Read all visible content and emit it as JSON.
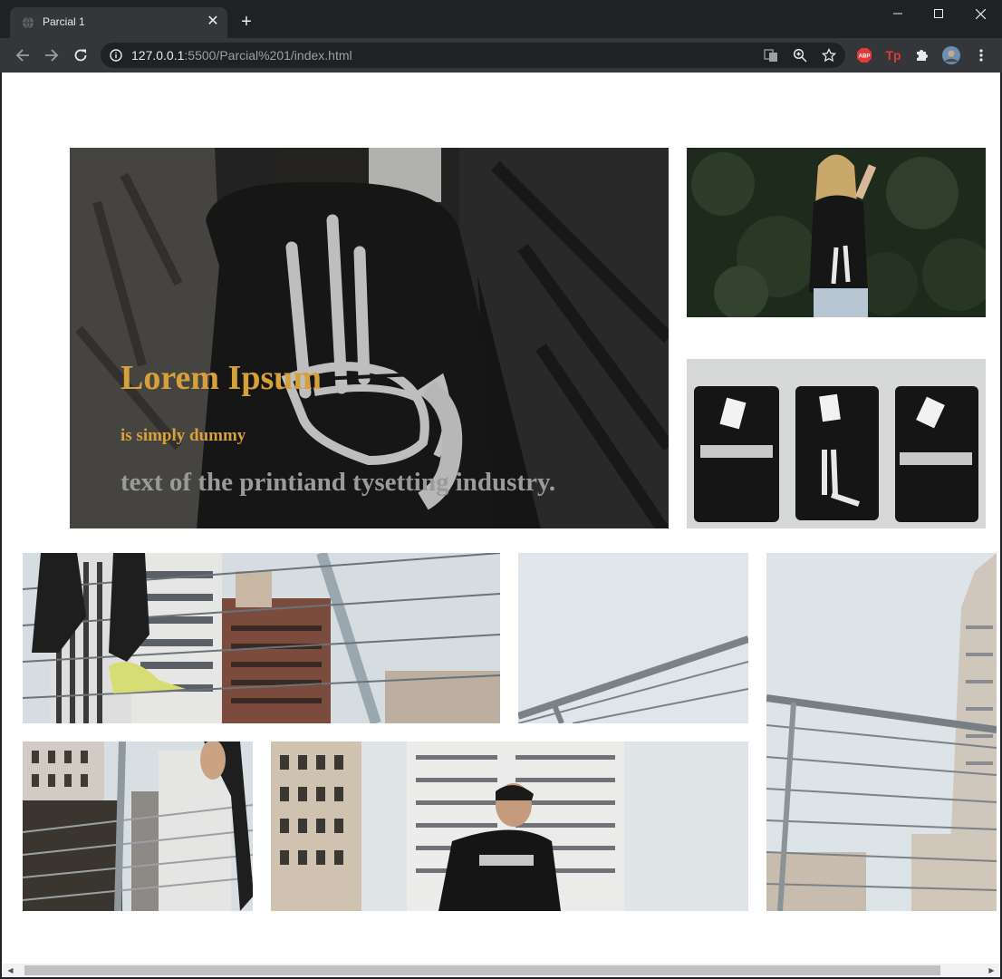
{
  "browser": {
    "tab_title": "Parcial 1",
    "new_tab_symbol": "+",
    "close_symbol": "✕",
    "url_host": "127.0.0.1",
    "url_rest": ":5500/Parcial%201/index.html",
    "extension_abp": "ABP",
    "extension_tp": "Tp"
  },
  "hero": {
    "title": "Lorem Ipsum",
    "subtitle": "is simply dummy",
    "text": "text of the printiand tysetting industry."
  },
  "colors": {
    "hero_title": "#d6a03a",
    "hero_subtitle": "#d9a23b",
    "hero_text": "#9a9a9a"
  }
}
